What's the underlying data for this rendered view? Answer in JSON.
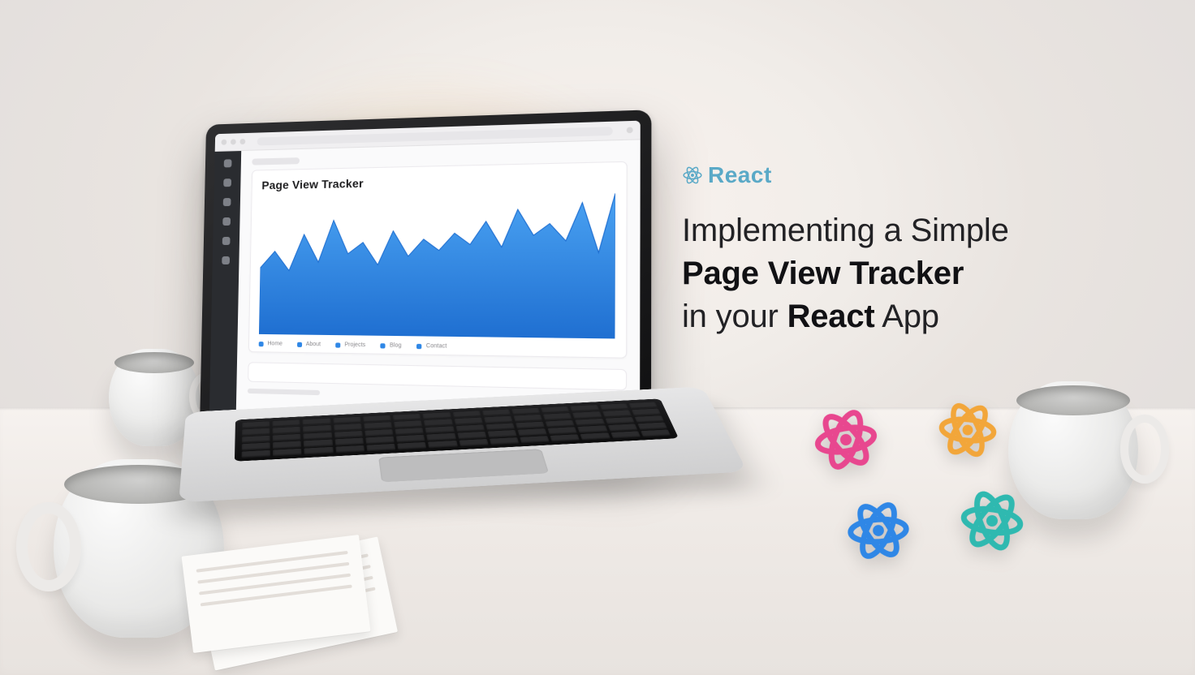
{
  "brand_label": "React",
  "headline": {
    "line1": "Implementing a Simple",
    "line2_bold": "Page View Tracker",
    "line3_pre": "in your ",
    "line3_bold": "React",
    "line3_post": " App"
  },
  "panel_title": "Page View Tracker",
  "chart_data": {
    "type": "area",
    "title": "Page View Tracker",
    "xlabel": "",
    "ylabel": "",
    "ylim": [
      0,
      100
    ],
    "x": [
      0,
      1,
      2,
      3,
      4,
      5,
      6,
      7,
      8,
      9,
      10,
      11,
      12,
      13,
      14,
      15,
      16,
      17,
      18,
      19,
      20,
      21,
      22,
      23
    ],
    "values": [
      48,
      60,
      46,
      72,
      52,
      82,
      58,
      66,
      50,
      74,
      56,
      68,
      60,
      72,
      64,
      80,
      62,
      88,
      70,
      78,
      66,
      92,
      58,
      98
    ],
    "legend": [
      "Home",
      "About",
      "Projects",
      "Blog",
      "Contact"
    ],
    "fill_color": "#2f87e6"
  },
  "legend_items": [
    "Home",
    "About",
    "Projects",
    "Blog",
    "Contact"
  ],
  "atom_colors": {
    "pink": "#e8478f",
    "yellow": "#f2a63a",
    "blue": "#2f87e6",
    "teal": "#2fb9b0"
  }
}
